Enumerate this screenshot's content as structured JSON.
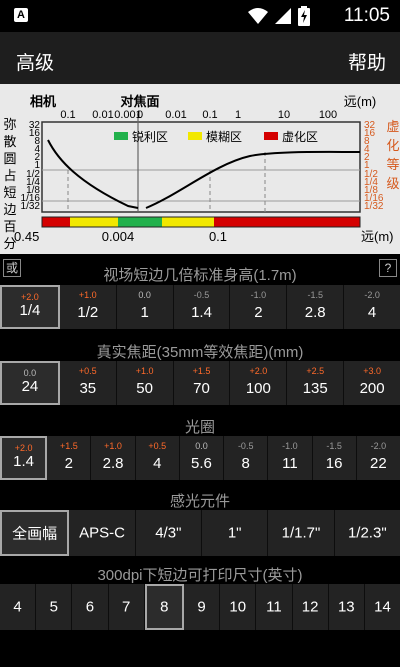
{
  "status_bar": {
    "time": "11:05",
    "app_icon": "A"
  },
  "app_bar": {
    "title": "高级",
    "help": "帮助"
  },
  "chart": {
    "top_left_label": "相机",
    "top_center_label": "对焦面",
    "top_right_label": "远(m)",
    "top_ticks": [
      "0.1",
      "0.01",
      "0.001",
      "0",
      "0.01",
      "0.1",
      "1",
      "10",
      "100"
    ],
    "left_labels": [
      "32",
      "16",
      "8",
      "4",
      "2",
      "1",
      "1/2",
      "1/4",
      "1/8",
      "1/16",
      "1/32"
    ],
    "right_labels": [
      "32",
      "16",
      "8",
      "4",
      "2",
      "1",
      "1/2",
      "1/4",
      "1/8",
      "1/16",
      "1/32"
    ],
    "left_axis_title": [
      "弥",
      "散",
      "圆",
      "占",
      "短",
      "边",
      "百",
      "分"
    ],
    "right_axis_title": [
      "虚",
      "化",
      "等",
      "级"
    ],
    "legend": [
      {
        "label": "锐利区",
        "color": "#22b14c"
      },
      {
        "label": "模糊区",
        "color": "#f2e800"
      },
      {
        "label": "虚化区",
        "color": "#d40000"
      }
    ],
    "bottom_left_value": "0.45",
    "bottom_mid_value": "0.004",
    "bottom_mid2_value": "0.1",
    "bottom_right_label": "远(m)",
    "colors": {
      "near_curve": "#000000",
      "far_curve": "#000000",
      "right_text": "#d65a1e"
    }
  },
  "section_view": {
    "title": "视场短边几倍标准身高(1.7m)",
    "left_button": "或",
    "right_button": "?",
    "items": [
      {
        "delta": "+2.0",
        "value": "1/4",
        "selected": true
      },
      {
        "delta": "+1.0",
        "value": "1/2"
      },
      {
        "delta": "0.0",
        "value": "1"
      },
      {
        "delta": "-0.5",
        "value": "1.4"
      },
      {
        "delta": "-1.0",
        "value": "2"
      },
      {
        "delta": "-1.5",
        "value": "2.8"
      },
      {
        "delta": "-2.0",
        "value": "4"
      }
    ]
  },
  "section_focal": {
    "title": "真实焦距(35mm等效焦距)(mm)",
    "items": [
      {
        "delta": "0.0",
        "value": "24",
        "selected": true
      },
      {
        "delta": "+0.5",
        "value": "35"
      },
      {
        "delta": "+1.0",
        "value": "50"
      },
      {
        "delta": "+1.5",
        "value": "70"
      },
      {
        "delta": "+2.0",
        "value": "100"
      },
      {
        "delta": "+2.5",
        "value": "135"
      },
      {
        "delta": "+3.0",
        "value": "200"
      }
    ]
  },
  "section_aperture": {
    "title": "光圈",
    "items": [
      {
        "delta": "+2.0",
        "value": "1.4",
        "selected": true
      },
      {
        "delta": "+1.5",
        "value": "2"
      },
      {
        "delta": "+1.0",
        "value": "2.8"
      },
      {
        "delta": "+0.5",
        "value": "4"
      },
      {
        "delta": "0.0",
        "value": "5.6"
      },
      {
        "delta": "-0.5",
        "value": "8"
      },
      {
        "delta": "-1.0",
        "value": "11"
      },
      {
        "delta": "-1.5",
        "value": "16"
      },
      {
        "delta": "-2.0",
        "value": "22"
      }
    ]
  },
  "section_sensor": {
    "title": "感光元件",
    "items": [
      {
        "value": "全画幅",
        "selected": true
      },
      {
        "value": "APS-C"
      },
      {
        "value": "4/3\""
      },
      {
        "value": "1\""
      },
      {
        "value": "1/1.7\""
      },
      {
        "value": "1/2.3\""
      }
    ]
  },
  "section_print": {
    "title": "300dpi下短边可打印尺寸(英寸)",
    "items": [
      {
        "value": "4"
      },
      {
        "value": "5"
      },
      {
        "value": "6"
      },
      {
        "value": "7"
      },
      {
        "value": "8",
        "selected": true
      },
      {
        "value": "9"
      },
      {
        "value": "10"
      },
      {
        "value": "11"
      },
      {
        "value": "12"
      },
      {
        "value": "13"
      },
      {
        "value": "14"
      }
    ]
  },
  "delta_colors": {
    "positive": "#ff6a2a",
    "zero": "#bbbbbb",
    "negative": "#9a9a9a"
  }
}
